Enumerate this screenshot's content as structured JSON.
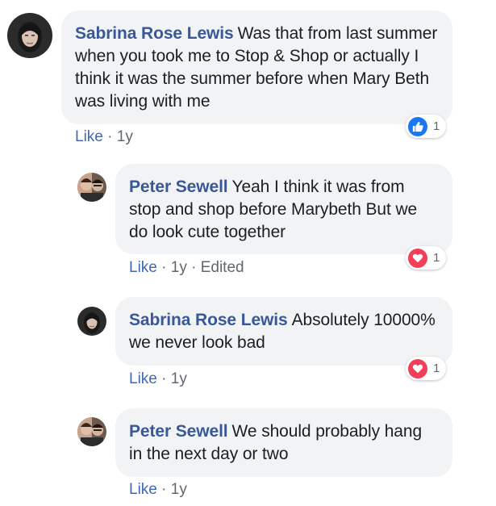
{
  "colors": {
    "author": "#385898",
    "like_link": "#4267b2",
    "bubble_bg": "#f2f3f5",
    "meta": "#606770",
    "like_reaction": "#1877f2",
    "love_reaction": "#f33e58"
  },
  "comments": [
    {
      "author": "Sabrina Rose Lewis",
      "text": "Was that from last summer when you took me to Stop & Shop or actually I think it was the summer before when Mary Beth was living with me",
      "like_label": "Like",
      "separator": " · ",
      "time": "1y",
      "edited": "",
      "reaction": {
        "icon": "thumbs-up-icon",
        "count": "1"
      }
    },
    {
      "author": "Peter Sewell",
      "text": "Yeah I think it was from stop and shop before Marybeth But we do look cute together",
      "like_label": "Like",
      "separator": " · ",
      "time": "1y",
      "edited": "Edited",
      "reaction": {
        "icon": "heart-icon",
        "count": "1"
      }
    },
    {
      "author": "Sabrina Rose Lewis",
      "text": "Absolutely 10000% we never look bad",
      "like_label": "Like",
      "separator": " · ",
      "time": "1y",
      "edited": "",
      "reaction": {
        "icon": "heart-icon",
        "count": "1"
      }
    },
    {
      "author": "Peter Sewell",
      "text": "We should probably hang in the next day or two",
      "like_label": "Like",
      "separator": " · ",
      "time": "1y",
      "edited": "",
      "reaction": null
    }
  ]
}
